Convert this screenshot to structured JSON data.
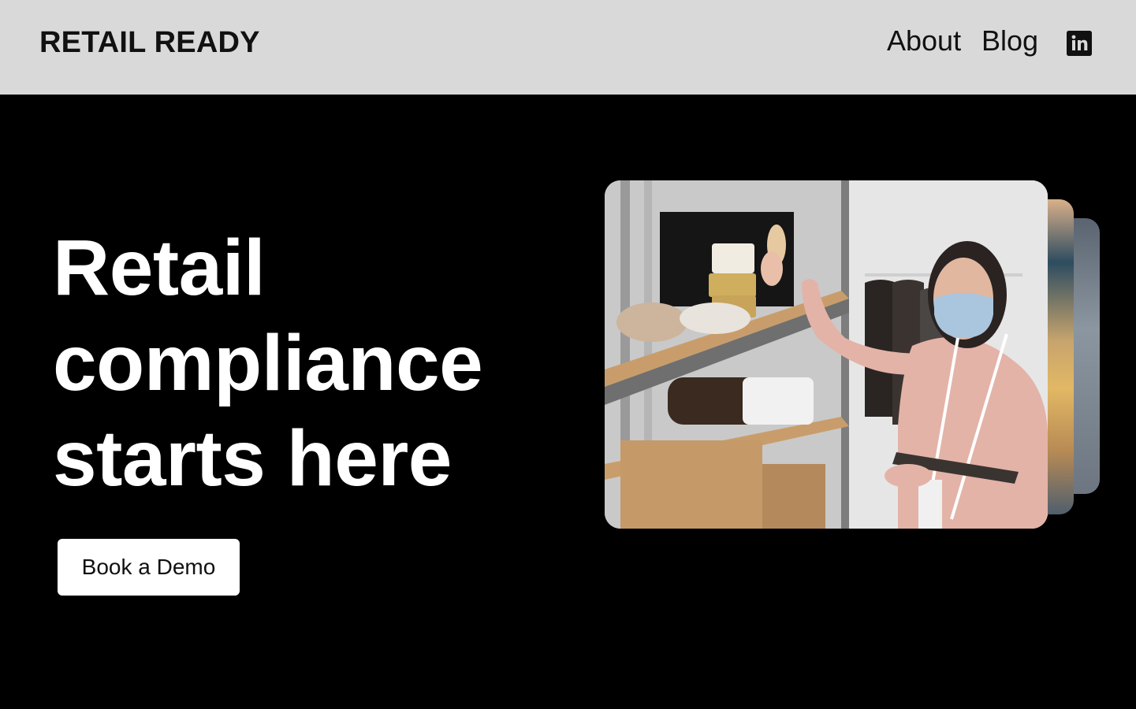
{
  "header": {
    "brand": "RETAIL READY",
    "nav": [
      {
        "label": "About"
      },
      {
        "label": "Blog"
      }
    ],
    "social_icon": "linkedin-icon"
  },
  "hero": {
    "headline_lines": [
      "Retail",
      "compliance",
      "starts here"
    ],
    "cta_label": "Book a Demo",
    "image_description_icon": "retail-worker-photo"
  },
  "colors": {
    "header_bg": "#d9d9d9",
    "hero_bg": "#000000",
    "text_dark": "#111111",
    "text_light": "#ffffff",
    "button_bg": "#ffffff"
  }
}
